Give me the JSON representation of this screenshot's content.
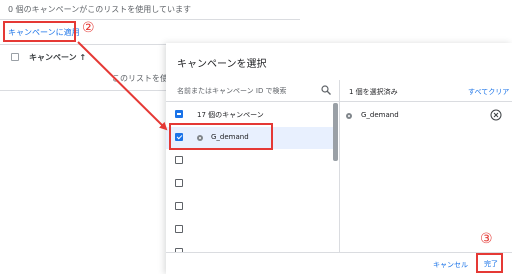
{
  "background": {
    "usage_text": "0 個のキャンペーンがこのリストを使用しています",
    "apply_link": "キャンペーンに適用",
    "column_header": "キャンペーン ↑",
    "partial_text": "このリストを使用し"
  },
  "dialog": {
    "title": "キャンペーンを選択",
    "search_placeholder": "名前またはキャンペーン ID で検索",
    "all_row_label": "17 個のキャンペーン",
    "campaign_rows": [
      {
        "label": "G_demand",
        "checked": true
      }
    ],
    "empty_rows": 5,
    "selected_count": "1 個を選択済み",
    "clear_all": "すべてクリア",
    "selected_items": [
      {
        "label": "G_demand"
      }
    ],
    "cancel": "キャンセル",
    "done": "完了"
  },
  "annotations": {
    "step2": "②",
    "step3": "③",
    "color": "#e53935"
  }
}
